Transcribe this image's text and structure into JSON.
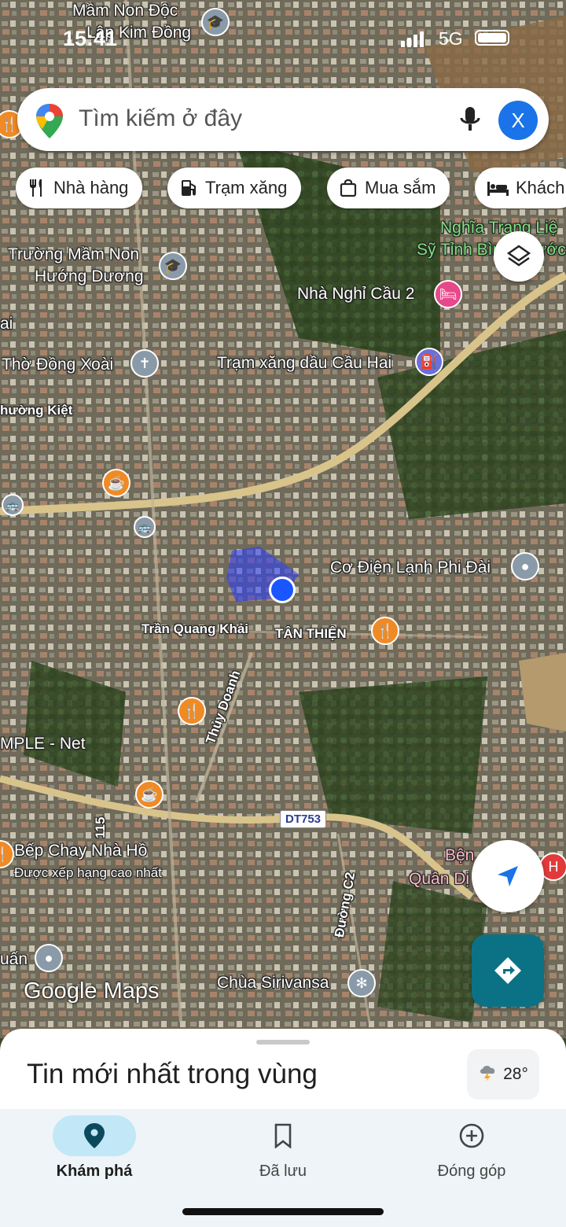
{
  "status": {
    "time": "15:41",
    "network": "5G"
  },
  "search": {
    "placeholder": "Tìm kiếm ở đây",
    "avatar_letter": "X"
  },
  "chips": [
    {
      "label": "Nhà hàng",
      "icon": "restaurant-icon"
    },
    {
      "label": "Trạm xăng",
      "icon": "gas-station-icon"
    },
    {
      "label": "Mua sắm",
      "icon": "shopping-bag-icon"
    },
    {
      "label": "Khách",
      "icon": "hotel-icon"
    }
  ],
  "map_labels": {
    "mam_non_doc": "Mầm Non Độc",
    "lap_kim_dong": "Lập Kim Đồng",
    "nghia_trang_1": "Nghĩa Trang Liệ",
    "nghia_trang_2": "Sỹ Tỉnh Bình Phước",
    "truong_mam_non_1": "Trường Mầm Non",
    "truong_mam_non_2": "Hướng Dương",
    "nha_nghi": "Nhà Nghỉ Cầu 2",
    "ai": "ai",
    "tho_dong_xoai": "Thờ Đồng Xoài",
    "tram_xang_cau_hai": "Trạm xăng dầu Cầu Hai",
    "thuong_kiet": "hường Kiệt",
    "co_dien_lanh": "Cơ Điện Lạnh Phi Đài",
    "tran_quang_khai": "Trần Quang Khải",
    "tan_thien": "TÂN THIỆN",
    "thuy_doanh": "Thủy Doanh",
    "mple_net": "MPLE - Net",
    "dt753": "DT753",
    "road_115": "115",
    "bep_chay": "Bếp Chay Nhà Hồ",
    "xep_hang": "Được xếp hạng cao nhất",
    "duong_c2": "Đường C2",
    "benh_1": "Bện",
    "benh_2": "Quân Dị",
    "quan": "uấn",
    "chua": "Chùa Sirivansa"
  },
  "watermark": "Google Maps",
  "sheet": {
    "title": "Tin mới nhất trong vùng",
    "temperature": "28°"
  },
  "nav": [
    {
      "label": "Khám phá",
      "icon": "explore-pin-icon",
      "active": true
    },
    {
      "label": "Đã lưu",
      "icon": "bookmark-icon",
      "active": false
    },
    {
      "label": "Đóng góp",
      "icon": "add-circle-icon",
      "active": false
    }
  ]
}
